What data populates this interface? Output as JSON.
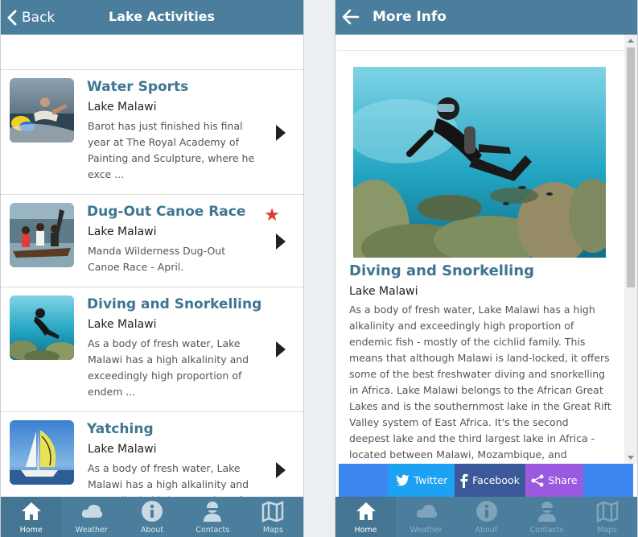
{
  "left_screen": {
    "header": {
      "back_label": "Back",
      "title": "Lake Activities"
    },
    "items": [
      {
        "title": "Water Sports",
        "subtitle": "Lake Malawi",
        "description": "Barot has just finished his final year at The Royal Academy of Painting and Sculpture, where he exce ...",
        "starred": false,
        "image": "water-sports-photo"
      },
      {
        "title": "Dug-Out Canoe Race",
        "subtitle": "Lake Malawi",
        "description": "Manda Wilderness Dug-Out Canoe Race - April.",
        "starred": true,
        "image": "canoe-race-photo"
      },
      {
        "title": "Diving and Snorkelling",
        "subtitle": "Lake Malawi",
        "description": "As a body of fresh water, Lake Malawi has a high alkalinity and exceedingly high proportion of endem ...",
        "starred": false,
        "image": "diving-photo"
      },
      {
        "title": "Yatching",
        "subtitle": "Lake Malawi",
        "description": "As a body of fresh water, Lake Malawi has a high alkalinity and exceedingly high proportion of",
        "starred": false,
        "image": "yacht-photo"
      }
    ],
    "tabs": [
      {
        "label": "Home",
        "icon": "home-icon",
        "active": true
      },
      {
        "label": "Weather",
        "icon": "cloud-icon",
        "active": false
      },
      {
        "label": "About",
        "icon": "info-icon",
        "active": false
      },
      {
        "label": "Contacts",
        "icon": "person-icon",
        "active": false
      },
      {
        "label": "Maps",
        "icon": "map-icon",
        "active": false
      }
    ]
  },
  "right_screen": {
    "header": {
      "title": "More Info"
    },
    "detail": {
      "title": "Diving and Snorkelling",
      "subtitle": "Lake Malawi",
      "body": "As a body of fresh water, Lake Malawi has a high alkalinity and exceedingly high proportion of endemic fish - mostly of the cichlid family. This means that although Malawi is land-locked, it offers some of the best freshwater diving and snorkelling in Africa. Lake Malawi belongs to the African Great Lakes and is the southernmost lake in the Great Rift Valley system of East Africa. It's the second deepest lake and the third largest lake in Africa - located between Malawi, Mozambique, and Tanzania - so"
    },
    "share": {
      "twitter": "Twitter",
      "facebook": "Facebook",
      "share": "Share"
    },
    "tabs": [
      {
        "label": "Home",
        "icon": "home-icon",
        "active": true
      },
      {
        "label": "Weather",
        "icon": "cloud-icon",
        "active": false
      },
      {
        "label": "About",
        "icon": "info-icon",
        "active": false
      },
      {
        "label": "Contacts",
        "icon": "person-icon",
        "active": false
      },
      {
        "label": "Maps",
        "icon": "map-icon",
        "active": false
      }
    ]
  },
  "colors": {
    "header": "#4a7e9c",
    "title_text": "#3e7691",
    "star": "#e03b2f",
    "twitter": "#1da1f2",
    "facebook": "#3b5998",
    "share": "#9b59e0",
    "share_bar": "#3d85f0"
  }
}
